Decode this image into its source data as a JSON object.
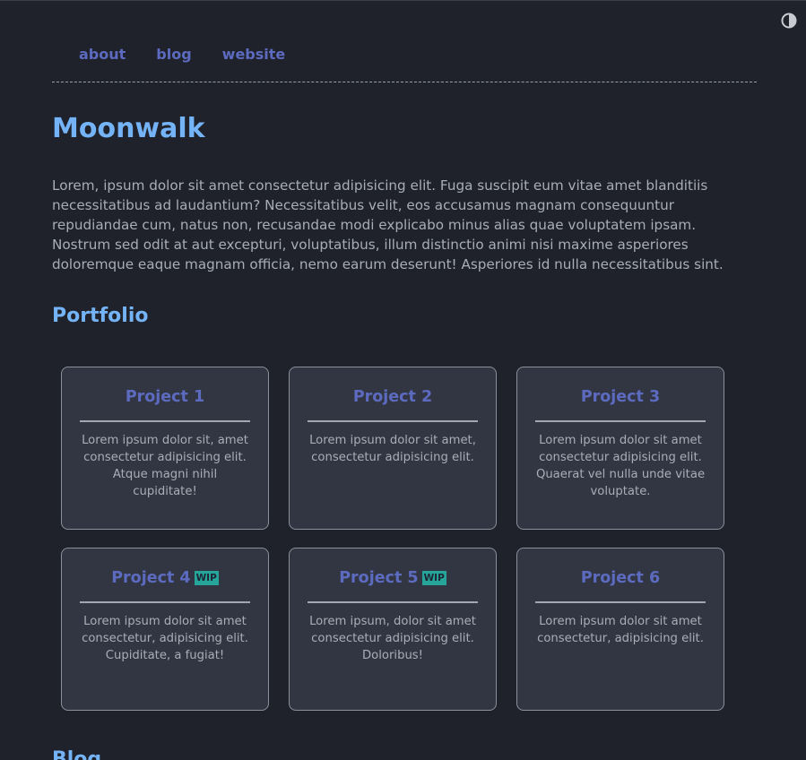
{
  "theme_toggle": {
    "icon": "half-circle-contrast-icon"
  },
  "nav": {
    "items": [
      {
        "label": "about"
      },
      {
        "label": "blog"
      },
      {
        "label": "website"
      }
    ]
  },
  "header": {
    "title": "Moonwalk"
  },
  "intro": {
    "text": "Lorem, ipsum dolor sit amet consectetur adipisicing elit. Fuga suscipit eum vitae amet blanditiis necessitatibus ad laudantium? Necessitatibus velit, eos accusamus magnam consequuntur repudiandae cum, natus non, recusandae modi explicabo minus alias quae voluptatem ipsam. Nostrum sed odit at aut excepturi, voluptatibus, illum distinctio animi nisi maxime asperiores doloremque eaque magnam officia, nemo earum deserunt! Asperiores id nulla necessitatibus sint."
  },
  "portfolio": {
    "title": "Portfolio",
    "projects": [
      {
        "title": "Project 1",
        "wip": "",
        "description": "Lorem ipsum dolor sit, amet consectetur adipisicing elit. Atque magni nihil cupiditate!"
      },
      {
        "title": "Project 2",
        "wip": "",
        "description": "Lorem ipsum dolor sit amet, consectetur adipisicing elit."
      },
      {
        "title": "Project 3",
        "wip": "",
        "description": "Lorem ipsum dolor sit amet consectetur adipisicing elit. Quaerat vel nulla unde vitae voluptate."
      },
      {
        "title": "Project 4",
        "wip": "WIP",
        "description": "Lorem ipsum dolor sit amet consectetur, adipisicing elit. Cupiditate, a fugiat!"
      },
      {
        "title": "Project 5",
        "wip": "WIP",
        "description": "Lorem ipsum, dolor sit amet consectetur adipisicing elit. Doloribus!"
      },
      {
        "title": "Project 6",
        "wip": "",
        "description": "Lorem ipsum dolor sit amet consectetur, adipisicing elit."
      }
    ]
  },
  "blog": {
    "title": "Blog"
  },
  "colors": {
    "background": "#1f222a",
    "heading": "#74b3f5",
    "link": "#5c6bc0",
    "card_background": "#323643",
    "wip_badge": "#26a69a",
    "body_text": "#a9adb5"
  }
}
